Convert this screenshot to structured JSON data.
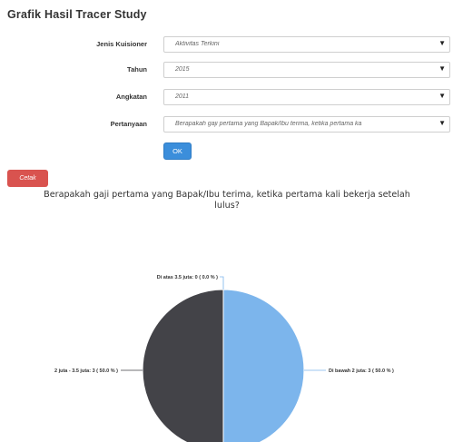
{
  "page": {
    "title": "Grafik Hasil Tracer Study"
  },
  "form": {
    "fields": [
      {
        "label": "Jenis Kuisioner",
        "value": "Aktivitas Terkini"
      },
      {
        "label": "Tahun",
        "value": "2015"
      },
      {
        "label": "Angkatan",
        "value": "2011"
      },
      {
        "label": "Pertanyaan",
        "value": "Berapakah gaji pertama yang Bapak/Ibu terima, ketika pertama ka"
      }
    ],
    "ok_label": "OK"
  },
  "actions": {
    "print_label": "Cetak"
  },
  "icons": {
    "dropdown": "chevron-down-icon"
  },
  "chart_data": {
    "type": "pie",
    "title": "Berapakah gaji pertama yang Bapak/Ibu terima, ketika pertama kali bekerja setelah lulus?",
    "slices": [
      {
        "name": "Di atas 3.5 juta",
        "label": "Di atas 3.5 juta: 0 ( 0.0 % )",
        "value": 0,
        "color": "#7ab8ee"
      },
      {
        "name": "Di bawah 2 juta",
        "label": "Di bawah 2 juta: 3 ( 50.0 % )",
        "value": 3,
        "color": "#7cb5ec"
      },
      {
        "name": "2 juta - 3.5 juta",
        "label": "2 juta - 3.5 juta: 3 ( 50.0 % )",
        "value": 3,
        "color": "#434348"
      }
    ]
  }
}
